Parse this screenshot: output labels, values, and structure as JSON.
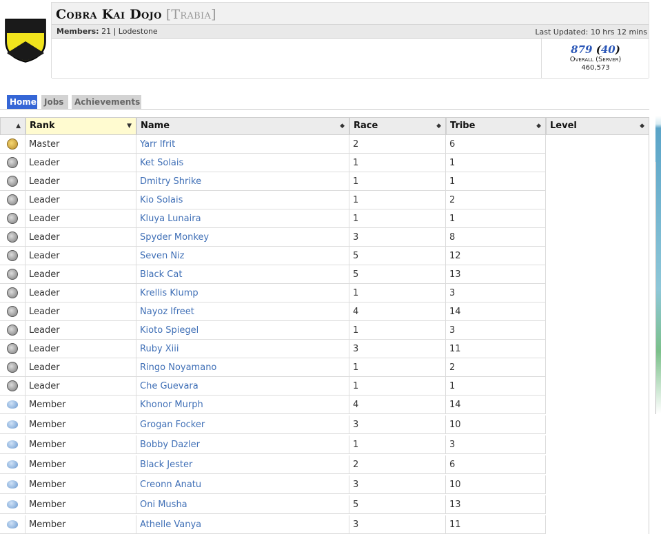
{
  "header": {
    "title": "Cobra Kai Dojo",
    "server": "[Trabia]",
    "members_label": "Members:",
    "members_value": "21 | Lodestone",
    "last_updated": "Last Updated: 10 hrs 12 mins",
    "rank_overall": "879",
    "rank_server": "40",
    "rank_open_paren": "(",
    "rank_close_paren": ")",
    "rank_label": "Overall (Server)",
    "score": "460,573"
  },
  "tabs": [
    {
      "label": "Home",
      "active": true
    },
    {
      "label": "Jobs",
      "active": false
    },
    {
      "label": "Achievements",
      "active": false
    }
  ],
  "table": {
    "columns": [
      "",
      "Rank",
      "Name",
      "Race",
      "Tribe",
      "Level"
    ],
    "rows": [
      {
        "icon": "master",
        "rank": "Master",
        "name": "Yarr Ifrit",
        "race": "2",
        "tribe": "6"
      },
      {
        "icon": "leader",
        "rank": "Leader",
        "name": "Ket Solais",
        "race": "1",
        "tribe": "1"
      },
      {
        "icon": "leader",
        "rank": "Leader",
        "name": "Dmitry Shrike",
        "race": "1",
        "tribe": "1"
      },
      {
        "icon": "leader",
        "rank": "Leader",
        "name": "Kio Solais",
        "race": "1",
        "tribe": "2"
      },
      {
        "icon": "leader",
        "rank": "Leader",
        "name": "Kluya Lunaira",
        "race": "1",
        "tribe": "1"
      },
      {
        "icon": "leader",
        "rank": "Leader",
        "name": "Spyder Monkey",
        "race": "3",
        "tribe": "8"
      },
      {
        "icon": "leader",
        "rank": "Leader",
        "name": "Seven Niz",
        "race": "5",
        "tribe": "12"
      },
      {
        "icon": "leader",
        "rank": "Leader",
        "name": "Black Cat",
        "race": "5",
        "tribe": "13"
      },
      {
        "icon": "leader",
        "rank": "Leader",
        "name": "Krellis Klump",
        "race": "1",
        "tribe": "3"
      },
      {
        "icon": "leader",
        "rank": "Leader",
        "name": "Nayoz Ifreet",
        "race": "4",
        "tribe": "14"
      },
      {
        "icon": "leader",
        "rank": "Leader",
        "name": "Kioto Spiegel",
        "race": "1",
        "tribe": "3"
      },
      {
        "icon": "leader",
        "rank": "Leader",
        "name": "Ruby Xiii",
        "race": "3",
        "tribe": "11"
      },
      {
        "icon": "leader",
        "rank": "Leader",
        "name": "Ringo Noyamano",
        "race": "1",
        "tribe": "2"
      },
      {
        "icon": "leader",
        "rank": "Leader",
        "name": "Che Guevara",
        "race": "1",
        "tribe": "1"
      },
      {
        "icon": "member",
        "rank": "Member",
        "name": "Khonor Murph",
        "race": "4",
        "tribe": "14"
      },
      {
        "icon": "member",
        "rank": "Member",
        "name": "Grogan Focker",
        "race": "3",
        "tribe": "10"
      },
      {
        "icon": "member",
        "rank": "Member",
        "name": "Bobby Dazler",
        "race": "1",
        "tribe": "3"
      },
      {
        "icon": "member",
        "rank": "Member",
        "name": "Black Jester",
        "race": "2",
        "tribe": "6"
      },
      {
        "icon": "member",
        "rank": "Member",
        "name": "Creonn Anatu",
        "race": "3",
        "tribe": "10"
      },
      {
        "icon": "member",
        "rank": "Member",
        "name": "Oni Musha",
        "race": "5",
        "tribe": "13"
      },
      {
        "icon": "member",
        "rank": "Member",
        "name": "Athelle Vanya",
        "race": "3",
        "tribe": "11"
      }
    ]
  },
  "colors": {
    "link": "#3f6fb6",
    "active_tab": "#3566d6",
    "sorted_header": "#fffbd0",
    "crest_yellow": "#f1e41d"
  },
  "icons": {
    "sort": "sort-arrows-icon",
    "sort_desc": "sort-desc-icon",
    "master": "master-rank-icon",
    "leader": "leader-rank-icon",
    "member": "member-rank-icon",
    "crest": "linkshell-crest-icon"
  }
}
